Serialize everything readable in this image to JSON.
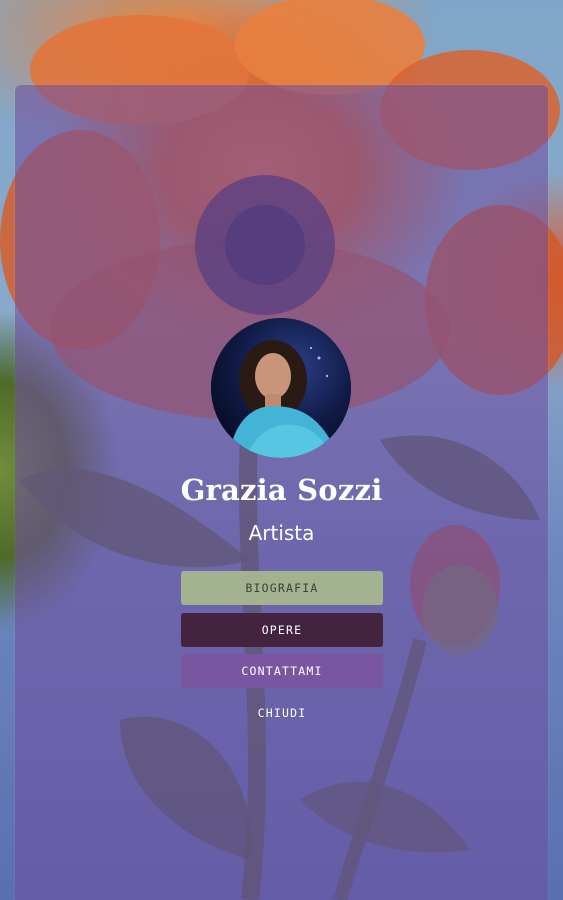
{
  "profile": {
    "name": "Grazia Sozzi",
    "role": "Artista"
  },
  "menu": {
    "items": [
      {
        "label": "BIOGRAFIA"
      },
      {
        "label": "OPERE"
      },
      {
        "label": "CONTATTAMI"
      },
      {
        "label": "CHIUDI"
      }
    ]
  },
  "colors": {
    "panel_overlay": "#6e50a0",
    "btn_biografia": "#a3b38f",
    "btn_opere": "#44233f",
    "btn_contattami": "#7a55a0",
    "text": "#ffffff"
  }
}
